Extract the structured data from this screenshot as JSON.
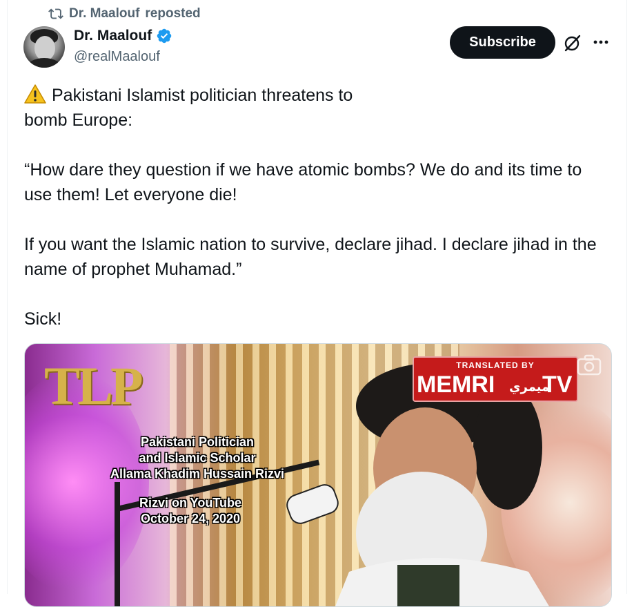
{
  "repost": {
    "icon": "repost-icon",
    "name": "Dr. Maalouf",
    "label": "reposted"
  },
  "author": {
    "display_name": "Dr. Maalouf",
    "handle": "@realMaalouf",
    "verified": true,
    "verified_color": "#1d9bf0",
    "avatar_icon": "avatar"
  },
  "actions": {
    "subscribe_label": "Subscribe",
    "grok_icon": "grok-icon",
    "more_icon": "more-icon"
  },
  "tweet": {
    "lines": [
      "Pakistani Islamist politician threatens to\nbomb Europe:",
      "“How dare they question if we have atomic bombs? We do and its time to use them! Let everyone die!",
      "If you want the Islamic nation to survive, declare jihad. I declare jihad in the name of prophet Muhamad.”",
      "Sick!"
    ],
    "warning_icon": "warning-icon"
  },
  "media": {
    "watermark": "TLP",
    "memri_translated": "TRANSLATED BY",
    "memri_brand": "MEMRI",
    "memri_arabic": "ميمري",
    "memri_tv": "TV",
    "caption_1": [
      "Pakistani Politician",
      "and Islamic Scholar",
      "Allama Khadim Hussain Rizvi"
    ],
    "caption_2": [
      "Rizvi on YouTube",
      "October 24, 2020"
    ]
  },
  "colors": {
    "text": "#0f1419",
    "secondary": "#536471",
    "subscribe_bg": "#0f1419",
    "memri_red": "#c51b1b"
  }
}
